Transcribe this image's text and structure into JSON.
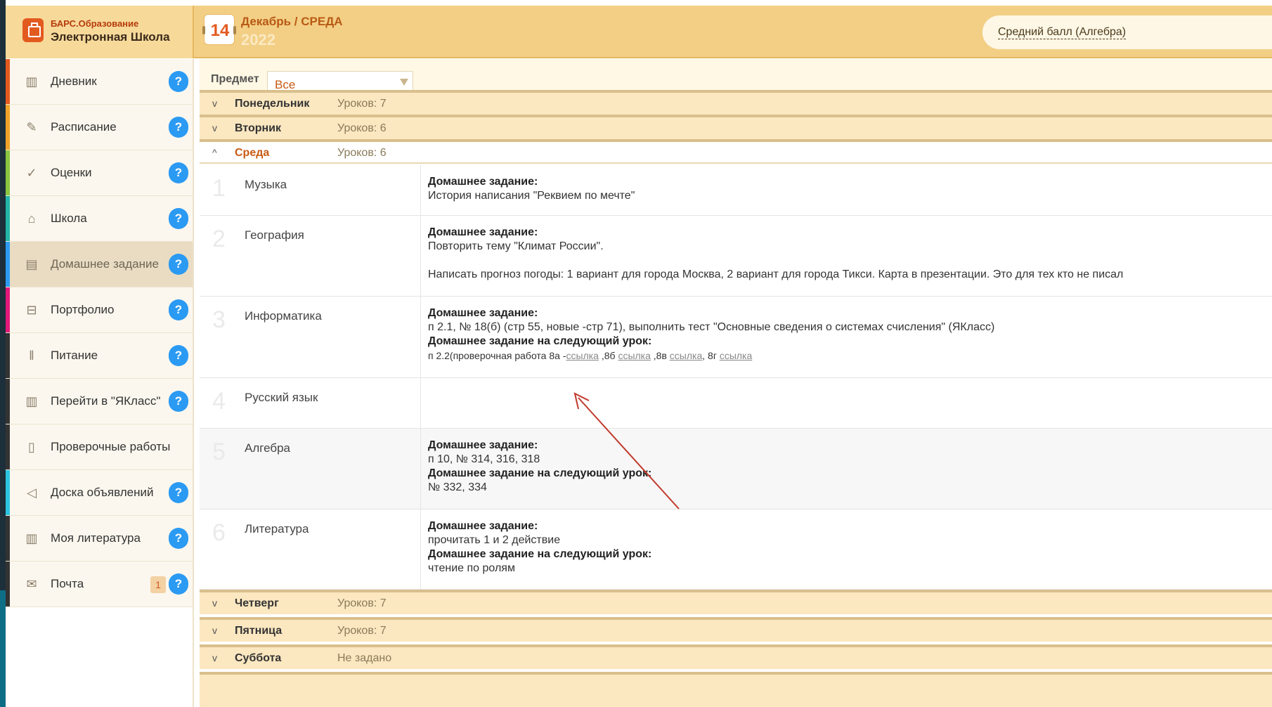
{
  "header": {
    "logo_line1": "БАРС.Образование",
    "logo_line2": "Электронная Школа",
    "date_day": "14",
    "date_month": "Декабрь / СРЕДА",
    "date_year": "2022",
    "average_label": "Средний балл (Алгебра)"
  },
  "sidebar": {
    "items": [
      {
        "label": "Дневник",
        "icon": "book-icon",
        "color": "#e35a1f",
        "help": "?"
      },
      {
        "label": "Расписание",
        "icon": "pen-icon",
        "color": "#f0a328",
        "help": "?"
      },
      {
        "label": "Оценки",
        "icon": "check-icon",
        "color": "#8cc63f",
        "help": "?"
      },
      {
        "label": "Школа",
        "icon": "school-icon",
        "color": "#22b5a8",
        "help": "?"
      },
      {
        "label": "Домашнее задание",
        "icon": "homework-icon",
        "color": "#2b9af3",
        "help": "?"
      },
      {
        "label": "Портфолио",
        "icon": "briefcase-icon",
        "color": "#e2187a",
        "help": "?"
      },
      {
        "label": "Питание",
        "icon": "cutlery-icon",
        "color": "#333333",
        "help": "?"
      },
      {
        "label": "Перейти в \"ЯКласс\"",
        "icon": "book-icon",
        "color": "#333333",
        "help": "?"
      },
      {
        "label": "Проверочные работы",
        "icon": "document-icon",
        "color": "#333333"
      },
      {
        "label": "Доска объявлений",
        "icon": "megaphone-icon",
        "color": "#2bc3e0",
        "help": "?"
      },
      {
        "label": "Моя литература",
        "icon": "book-icon",
        "color": "#333333",
        "help": "?"
      },
      {
        "label": "Почта",
        "icon": "mail-icon",
        "color": "#333333",
        "help": "?",
        "count": "1"
      }
    ]
  },
  "filter": {
    "label": "Предмет",
    "value": "Все"
  },
  "days": {
    "mon": {
      "name": "Понедельник",
      "count": "Уроков: 7",
      "chev": "v"
    },
    "tue": {
      "name": "Вторник",
      "count": "Уроков: 6",
      "chev": "v"
    },
    "wed": {
      "name": "Среда",
      "count": "Уроков: 6",
      "chev": "^"
    },
    "thu": {
      "name": "Четверг",
      "count": "Уроков: 7",
      "chev": "v"
    },
    "fri": {
      "name": "Пятница",
      "count": "Уроков: 7",
      "chev": "v"
    },
    "sat": {
      "name": "Суббота",
      "count": "Не задано",
      "chev": "v"
    }
  },
  "lessons": {
    "l1": {
      "num": "1",
      "subject": "Музыка",
      "hw_title": "Домашнее задание:",
      "hw_text": "История написания \"Реквием по мечте\""
    },
    "l2": {
      "num": "2",
      "subject": "География",
      "hw_title": "Домашнее задание:",
      "hw_text1": "Повторить тему \"Климат России\".",
      "hw_text2": "Написать прогноз погоды: 1 вариант для города Москва, 2 вариант для города Тикси. Карта в презентации. Это для тех кто не писал"
    },
    "l3": {
      "num": "3",
      "subject": "Информатика",
      "hw_title": "Домашнее задание:",
      "hw_text": "п 2.1, № 18(б) (стр 55, новые -стр 71), выполнить тест \"Основные сведения о системах счисления\" (ЯКласс)",
      "next_title": "Домашнее задание на следующий урок:",
      "next_prefix": "п 2.2(проверочная работа 8а -",
      "link": "ссылка",
      "sep_b": " ,8б ",
      "sep_v": " ,8в ",
      "sep_g": ", 8г "
    },
    "l4": {
      "num": "4",
      "subject": "Русский язык"
    },
    "l5": {
      "num": "5",
      "subject": "Алгебра",
      "hw_title": "Домашнее задание:",
      "hw_text": "п 10, № 314, 316, 318",
      "next_title": "Домашнее задание на следующий урок:",
      "next_text": "№ 332, 334"
    },
    "l6": {
      "num": "6",
      "subject": "Литература",
      "hw_title": "Домашнее задание:",
      "hw_text": "прочитать 1 и 2 действие",
      "next_title": "Домашнее задание на следующий урок:",
      "next_text": "чтение по ролям"
    }
  },
  "colors": {
    "accent": "#e35a1f",
    "header_bg": "#f3cf86",
    "annotation_arrow": "#c0392b"
  }
}
